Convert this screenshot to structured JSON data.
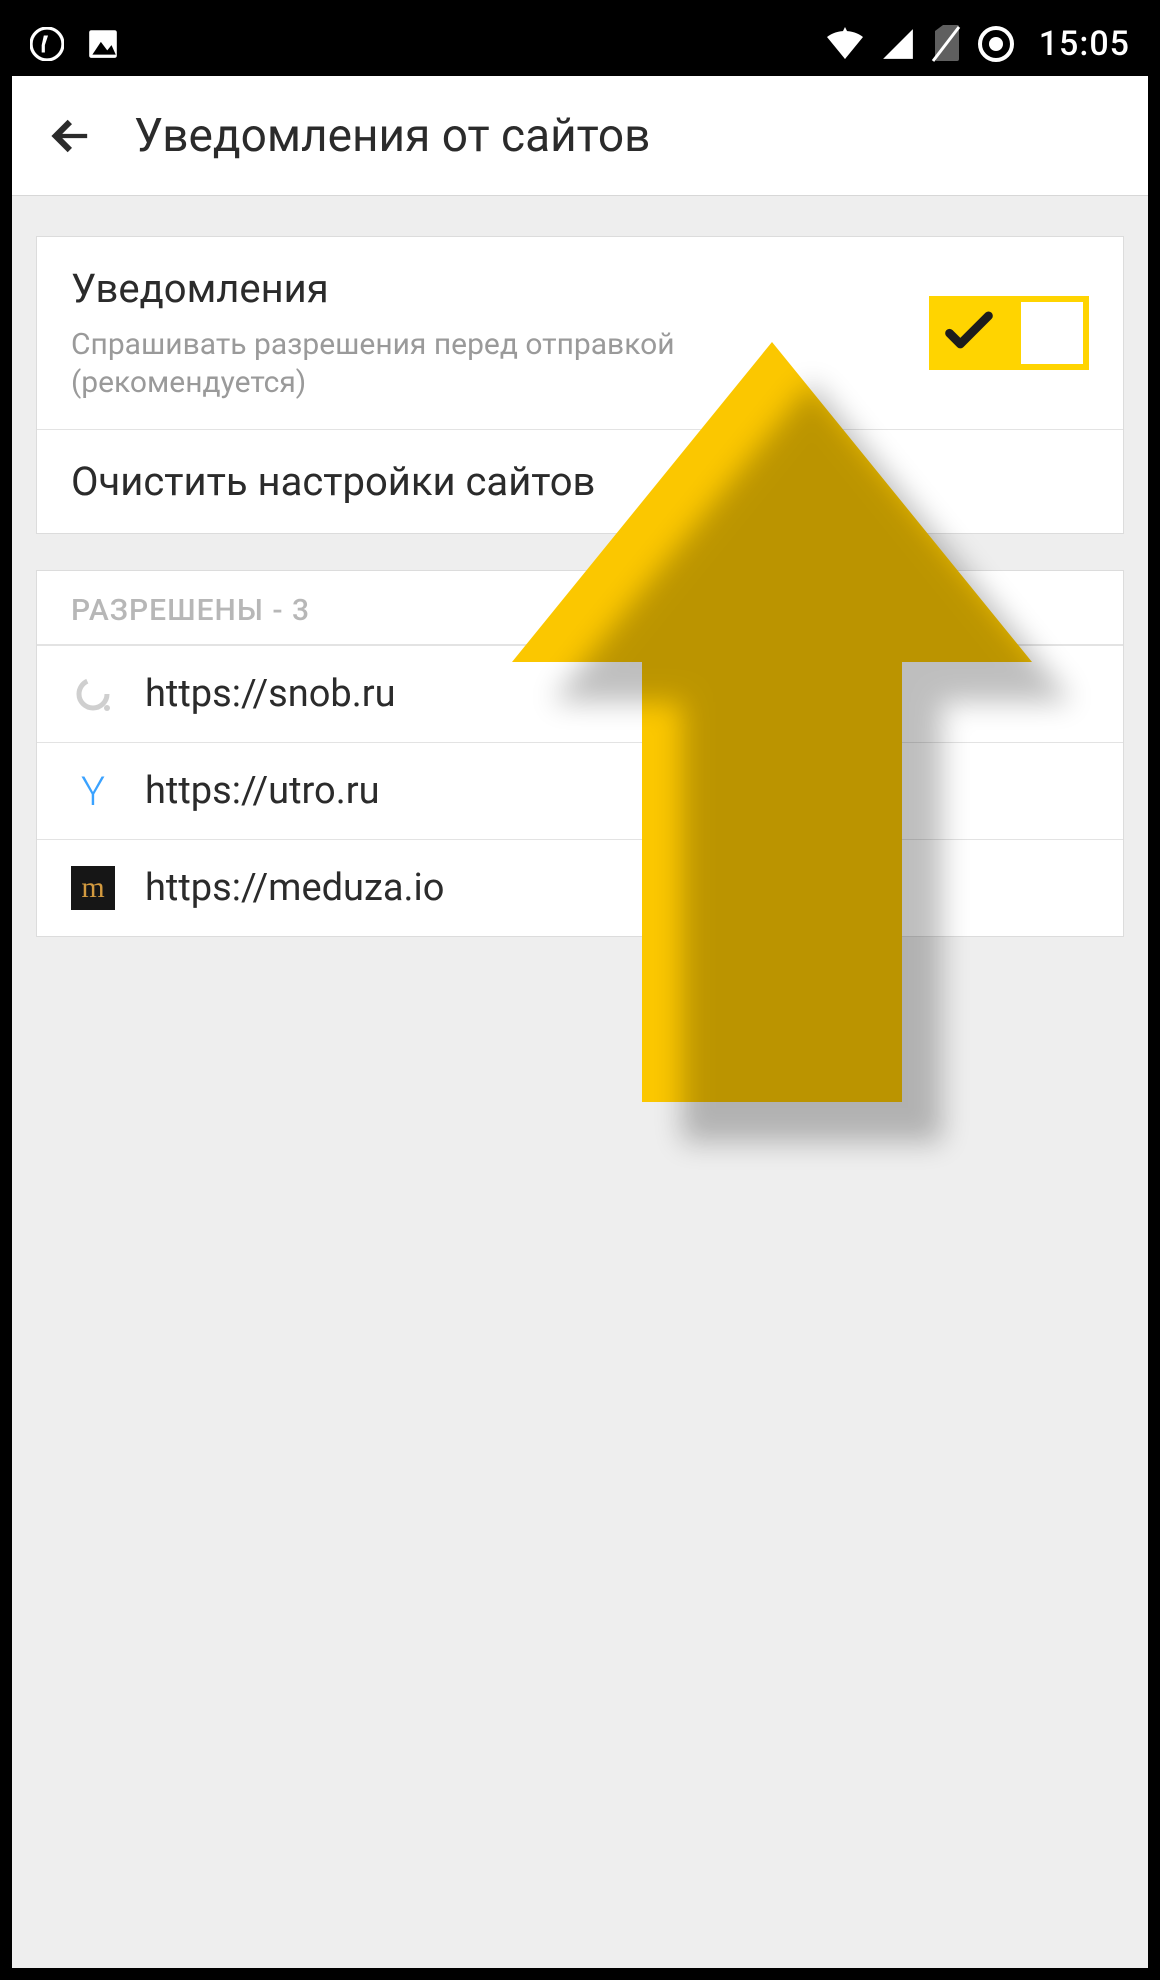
{
  "status": {
    "time": "15:05"
  },
  "appbar": {
    "title": "Уведомления от сайтов"
  },
  "settings": {
    "notifications_title": "Уведомления",
    "notifications_subtitle": "Спрашивать разрешения перед отправкой (рекомендуется)",
    "clear_label": "Очистить настройки сайтов"
  },
  "allowed": {
    "header": "РАЗРЕШЕНЫ - 3",
    "sites": [
      {
        "url": "https://snob.ru",
        "favicon": "snob"
      },
      {
        "url": "https://utro.ru",
        "favicon": "utro"
      },
      {
        "url": "https://meduza.io",
        "favicon": "meduza"
      }
    ]
  },
  "colors": {
    "accent": "#ffd400"
  }
}
